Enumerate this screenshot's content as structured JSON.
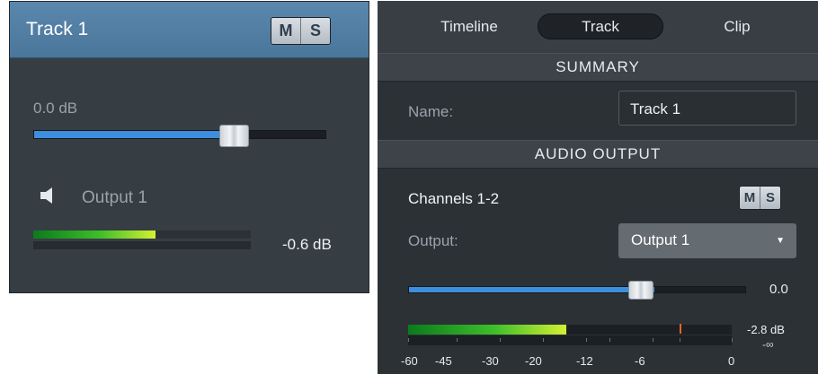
{
  "left_panel": {
    "track_title": "Track 1",
    "mute_label": "M",
    "solo_label": "S",
    "gain_value": "0.0 dB",
    "gain_fraction": 0.72,
    "output_label": "Output 1",
    "meter_level_fraction": 0.56,
    "meter_readout": "-0.6 dB",
    "speaker_icon": "speaker-icon"
  },
  "right_panel": {
    "tabs": [
      "Timeline",
      "Track",
      "Clip"
    ],
    "active_tab": "Track",
    "summary_header": "SUMMARY",
    "name_label": "Name:",
    "name_value": "Track 1",
    "audio_output_header": "AUDIO OUTPUT",
    "channels_label": "Channels 1-2",
    "mute_label": "M",
    "solo_label": "S",
    "output_label": "Output:",
    "output_value": "Output 1",
    "dropdown_icon": "chevron-down-icon",
    "gain_value": "0.0",
    "gain_fraction": 0.73,
    "meter_readout": "-2.8 dB",
    "meter_min_readout": "-∞",
    "meter_level_fraction": 0.49,
    "scale": [
      "-60",
      "-45",
      "-30",
      "-20",
      "-12",
      "-6",
      "0"
    ]
  },
  "colors": {
    "left_header": "#4f7ba2",
    "slider_fill": "#3d8ede",
    "meter_green": "#3fbf2a",
    "peak_marker": "#e0662a"
  }
}
